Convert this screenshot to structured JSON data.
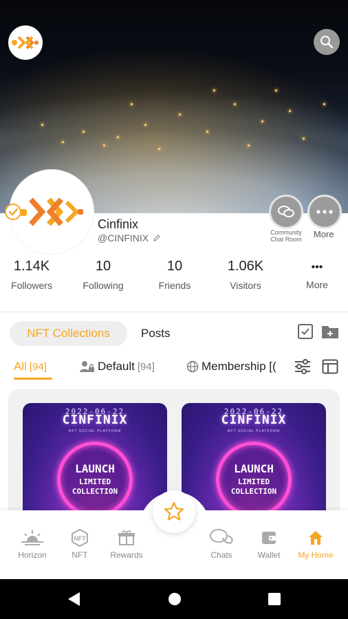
{
  "colors": {
    "accent": "#f5a623",
    "nft_bg": "#3b1e8a",
    "ring": "#ff4fd8"
  },
  "profile": {
    "name": "Cinfinix",
    "handle": "@CINFINIX",
    "community_label": "Community Chat Room",
    "more_label": "More"
  },
  "stats": [
    {
      "value": "1.14K",
      "label": "Followers"
    },
    {
      "value": "10",
      "label": "Following"
    },
    {
      "value": "10",
      "label": "Friends"
    },
    {
      "value": "1.06K",
      "label": "Visitors"
    },
    {
      "value": "•••",
      "label": "More"
    }
  ],
  "tabs": {
    "active": "NFT Collections",
    "other": "Posts"
  },
  "filters": {
    "all_label": "All",
    "all_count": "[94]",
    "default_label": "Default",
    "default_count": "[94]",
    "membership_label": "Membership [("
  },
  "nft": {
    "date": "2022-06-22",
    "title": "CINFINIX",
    "subtitle": "NFT SOCIAL PLATFORM",
    "launch": "LAUNCH",
    "limited": "LIMITED",
    "collection": "COLLECTION"
  },
  "nav": [
    {
      "label": "Horizon",
      "icon": "horizon-icon"
    },
    {
      "label": "NFT",
      "icon": "nft-icon"
    },
    {
      "label": "Rewards",
      "icon": "rewards-icon"
    },
    {
      "label": "Chats",
      "icon": "chats-icon"
    },
    {
      "label": "Wallet",
      "icon": "wallet-icon"
    },
    {
      "label": "My Home",
      "icon": "home-icon",
      "active": true
    }
  ]
}
